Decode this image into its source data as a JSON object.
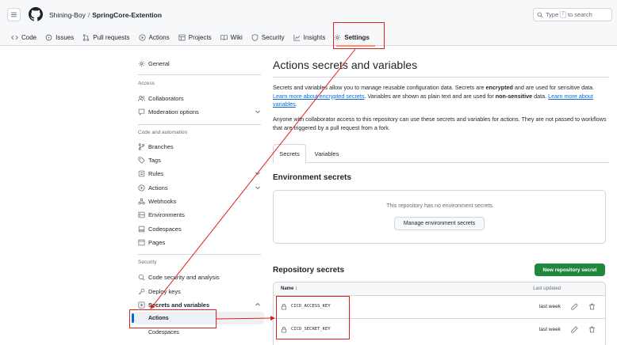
{
  "header": {
    "owner": "Shining-Boy",
    "separator": "/",
    "repo": "SpringCore-Extention",
    "search_prefix": "Type",
    "search_key": "/",
    "search_suffix": "to search"
  },
  "repo_nav": [
    {
      "label": "Code",
      "icon": "code-icon"
    },
    {
      "label": "Issues",
      "icon": "issue-icon"
    },
    {
      "label": "Pull requests",
      "icon": "pull-request-icon"
    },
    {
      "label": "Actions",
      "icon": "play-icon"
    },
    {
      "label": "Projects",
      "icon": "table-icon"
    },
    {
      "label": "Wiki",
      "icon": "book-icon"
    },
    {
      "label": "Security",
      "icon": "shield-icon"
    },
    {
      "label": "Insights",
      "icon": "graph-icon"
    },
    {
      "label": "Settings",
      "icon": "gear-icon",
      "active": true
    }
  ],
  "sidebar": {
    "general": "General",
    "access_heading": "Access",
    "collaborators": "Collaborators",
    "moderation": "Moderation options",
    "code_heading": "Code and automation",
    "branches": "Branches",
    "tags": "Tags",
    "rules": "Rules",
    "actions": "Actions",
    "webhooks": "Webhooks",
    "environments": "Environments",
    "codespaces": "Codespaces",
    "pages": "Pages",
    "security_heading": "Security",
    "code_security": "Code security and analysis",
    "deploy_keys": "Deploy keys",
    "secrets_variables": "Secrets and variables",
    "sub_actions": "Actions",
    "sub_codespaces": "Codespaces"
  },
  "main": {
    "title": "Actions secrets and variables",
    "desc_1": "Secrets and variables allow you to manage reusable configuration data. Secrets are ",
    "desc_encrypted": "encrypted",
    "desc_2": " and are used for sensitive data. ",
    "desc_link_1": "Learn more about encrypted secrets",
    "desc_3": ". Variables are shown as plain text and are used for ",
    "desc_nonsensitive": "non-sensitive",
    "desc_4": " data. ",
    "desc_link_2": "Learn more about variables",
    "desc_5": ".",
    "desc_collab": "Anyone with collaborator access to this repository can use these secrets and variables for actions. They are not passed to workflows that are triggered by a pull request from a fork.",
    "tabs": [
      "Secrets",
      "Variables"
    ],
    "env_title": "Environment secrets",
    "env_empty": "This repository has no environment secrets.",
    "env_button": "Manage environment secrets",
    "repo_title": "Repository secrets",
    "new_secret_button": "New repository secret",
    "table_name_header": "Name",
    "table_sort_glyph": "↕",
    "table_updated_header": "Last updated",
    "secrets": [
      {
        "name": "CICD_ACCESS_KEY",
        "updated": "last week"
      },
      {
        "name": "CICD_SECRET_KEY",
        "updated": "last week"
      }
    ]
  },
  "colors": {
    "accent": "#0969da",
    "primary_button": "#1f883d",
    "annotation": "#e01e1e",
    "tab_underline": "#fd8c73"
  }
}
